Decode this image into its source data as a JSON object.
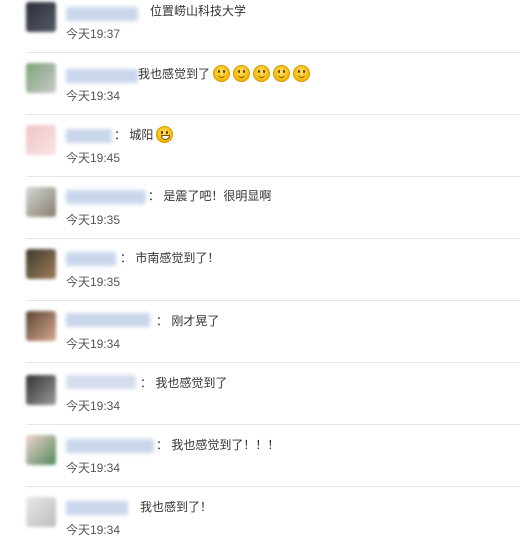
{
  "comments": [
    {
      "separator": "",
      "text": "位置崂山科技大学",
      "time": "今天19:37",
      "emoji": []
    },
    {
      "separator": "",
      "text": "我也感觉到了",
      "time": "今天19:34",
      "emoji": [
        "smile-icon",
        "smile-icon",
        "smile-icon",
        "smile-icon",
        "smile-icon"
      ]
    },
    {
      "separator": "：",
      "text": "城阳",
      "time": "今天19:45",
      "emoji": [
        "laugh-icon"
      ]
    },
    {
      "separator": "：",
      "text": "是震了吧！很明显啊",
      "time": "今天19:35",
      "emoji": []
    },
    {
      "separator": "：",
      "text": "市南感觉到了！",
      "time": "今天19:35",
      "emoji": []
    },
    {
      "separator": "：",
      "text": "刚才晃了",
      "time": "今天19:34",
      "emoji": []
    },
    {
      "separator": "：",
      "text": "我也感觉到了",
      "time": "今天19:34",
      "emoji": []
    },
    {
      "separator": "：",
      "text": "我也感觉到了！！！",
      "time": "今天19:34",
      "emoji": []
    },
    {
      "separator": "",
      "text": "我也感到了！",
      "time": "今天19:34",
      "emoji": []
    }
  ]
}
